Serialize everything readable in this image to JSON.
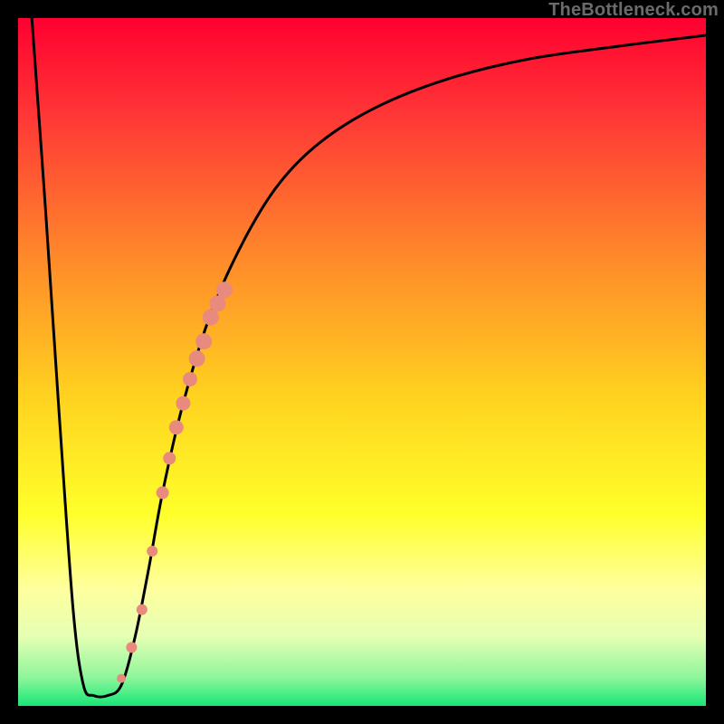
{
  "watermark": "TheBottleneck.com",
  "chart_data": {
    "type": "line",
    "title": "",
    "xlabel": "",
    "ylabel": "",
    "xlim": [
      0,
      100
    ],
    "ylim": [
      0,
      100
    ],
    "grid": false,
    "legend": false,
    "background_gradient": {
      "direction": "vertical",
      "stops": [
        {
          "pos": 0.0,
          "color": "#ff0030"
        },
        {
          "pos": 0.15,
          "color": "#ff3a36"
        },
        {
          "pos": 0.35,
          "color": "#ff8a2a"
        },
        {
          "pos": 0.55,
          "color": "#ffd21f"
        },
        {
          "pos": 0.72,
          "color": "#ffff2a"
        },
        {
          "pos": 0.83,
          "color": "#ffff9e"
        },
        {
          "pos": 0.9,
          "color": "#e4ffb4"
        },
        {
          "pos": 0.96,
          "color": "#8cf59a"
        },
        {
          "pos": 1.0,
          "color": "#16e777"
        }
      ]
    },
    "series": [
      {
        "name": "bottleneck-curve",
        "color": "#000000",
        "x": [
          2,
          4,
          6,
          8,
          9.5,
          11,
          13,
          15,
          17,
          19,
          21,
          24,
          28,
          33,
          38,
          44,
          52,
          62,
          74,
          88,
          100
        ],
        "y": [
          100,
          72,
          42,
          14,
          3,
          1.5,
          1.5,
          3,
          10,
          20,
          31,
          44,
          57,
          68,
          76,
          82,
          87,
          91,
          94,
          96,
          97.5
        ]
      },
      {
        "name": "highlight-dots",
        "color": "#e88a7d",
        "type": "scatter",
        "x": [
          15.0,
          16.5,
          18.0,
          19.5,
          21.0,
          22.0,
          23.0,
          24.0,
          25.0,
          26.0,
          27.0,
          28.0,
          29.0,
          30.0
        ],
        "y": [
          4.0,
          8.5,
          14.0,
          22.5,
          31.0,
          36.0,
          40.5,
          44.0,
          47.5,
          50.5,
          53.0,
          56.5,
          58.5,
          60.5
        ],
        "r": [
          5,
          6,
          6,
          6,
          7,
          7,
          8,
          8,
          8,
          9,
          9,
          9,
          9,
          9
        ]
      }
    ]
  }
}
